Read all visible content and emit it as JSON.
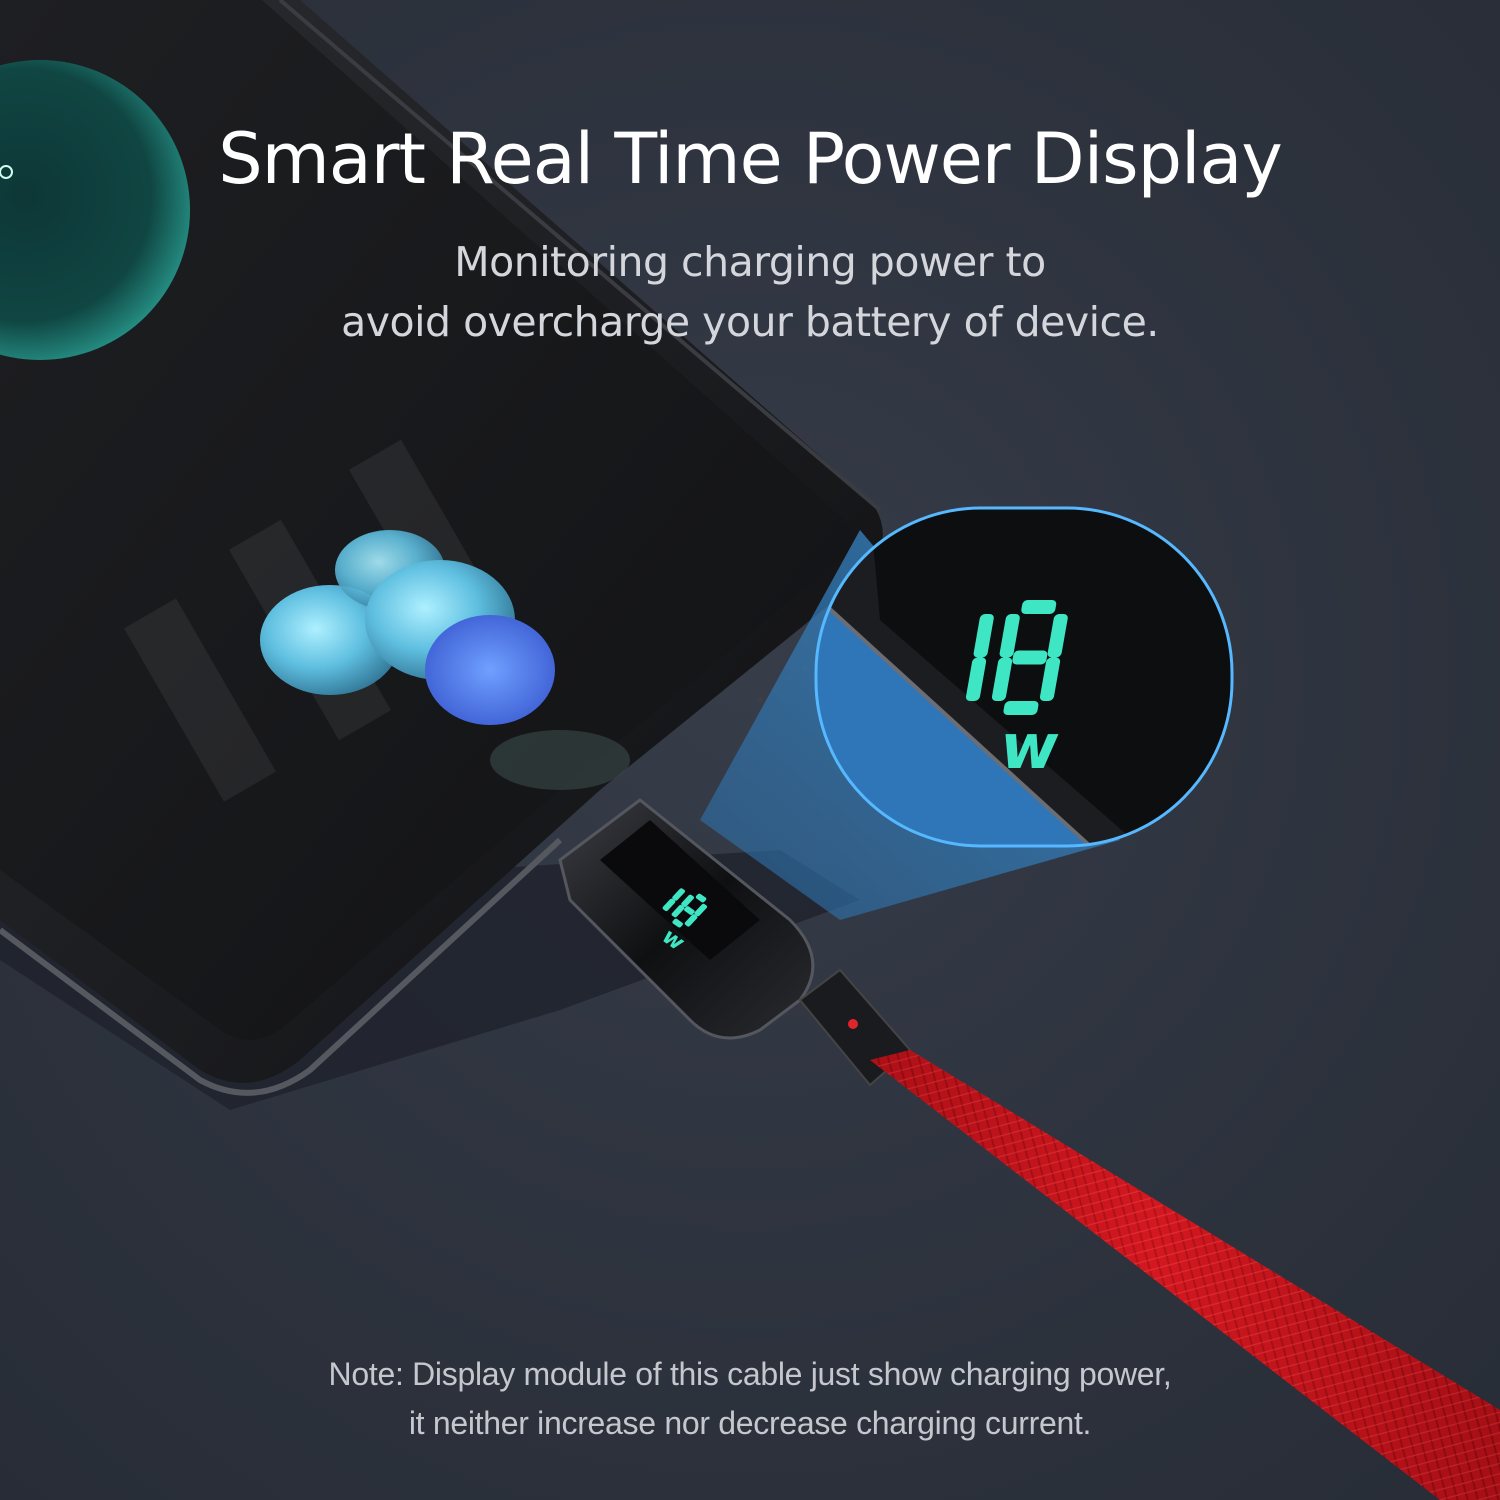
{
  "headline": "Smart Real Time Power Display",
  "subheadline": {
    "line1": "Monitoring charging power to",
    "line2": "avoid overcharge your battery of device."
  },
  "display_readout": {
    "value": "18",
    "unit": "W"
  },
  "note": {
    "line1": "Note: Display module of this cable just show charging power,",
    "line2": "it neither increase nor decrease charging current."
  },
  "colors": {
    "background": "#2d333f",
    "display_digits": "#3fe6c4",
    "cable": "#c8141c",
    "magnifier_glow": "#3fa4e0"
  }
}
